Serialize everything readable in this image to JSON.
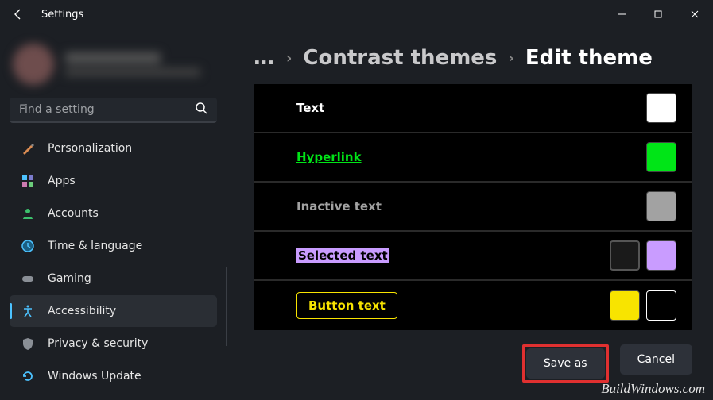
{
  "app": {
    "title": "Settings"
  },
  "search": {
    "placeholder": "Find a setting"
  },
  "nav": {
    "items": [
      {
        "label": "Personalization"
      },
      {
        "label": "Apps"
      },
      {
        "label": "Accounts"
      },
      {
        "label": "Time & language"
      },
      {
        "label": "Gaming"
      },
      {
        "label": "Accessibility"
      },
      {
        "label": "Privacy & security"
      },
      {
        "label": "Windows Update"
      }
    ]
  },
  "breadcrumb": {
    "ellipsis": "…",
    "parent": "Contrast themes",
    "current": "Edit theme"
  },
  "theme": {
    "rows": [
      {
        "id": "text",
        "label": "Text",
        "swatches": [
          "#ffffff"
        ]
      },
      {
        "id": "hyperlink",
        "label": "Hyperlink",
        "swatches": [
          "#00e517"
        ]
      },
      {
        "id": "inactive-text",
        "label": "Inactive text",
        "swatches": [
          "#a2a2a2"
        ]
      },
      {
        "id": "selected-text",
        "label": "Selected text",
        "swatches": [
          "#1a1a1a",
          "#c99cff"
        ]
      },
      {
        "id": "button-text",
        "label": "Button text",
        "swatches": [
          "#f8e400",
          "#000000"
        ]
      }
    ]
  },
  "footer": {
    "save_as": "Save as",
    "cancel": "Cancel"
  },
  "watermark": "BuildWindows.com"
}
